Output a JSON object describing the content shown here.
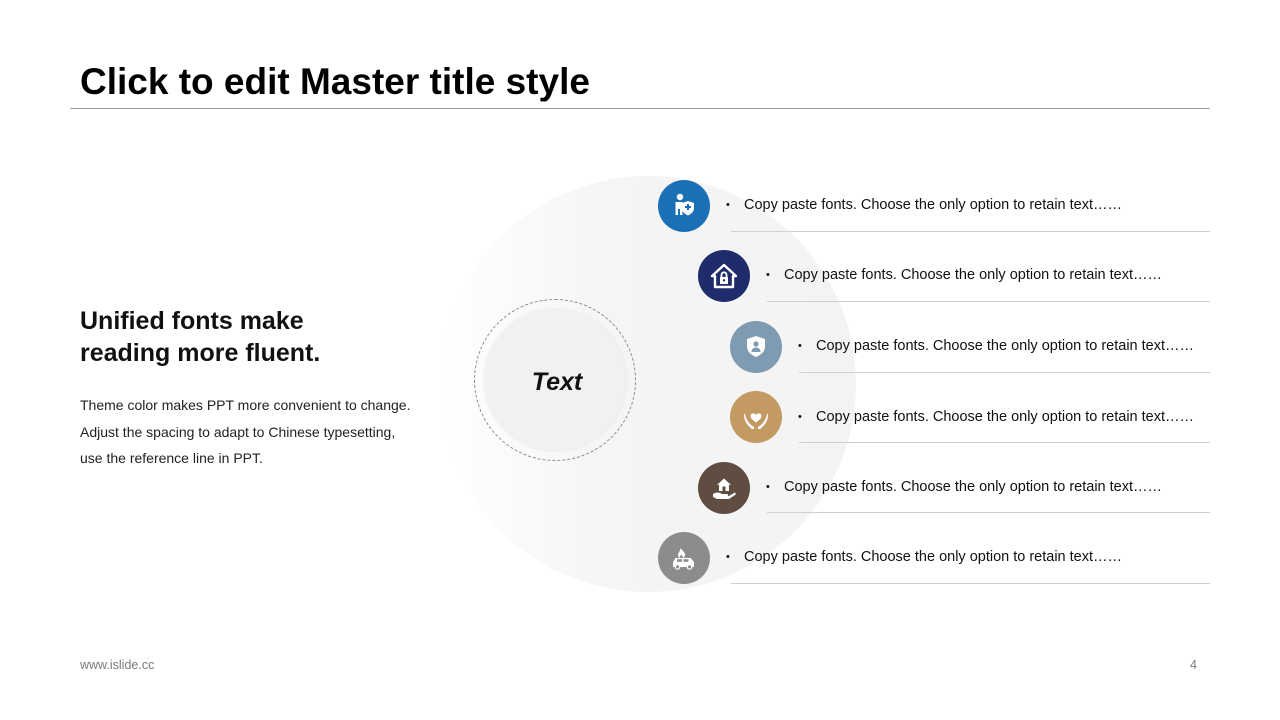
{
  "slide": {
    "title": "Click to edit Master title style",
    "heading_line1": "Unified fonts make",
    "heading_line2": "reading more fluent.",
    "body_lines": [
      "Theme color makes PPT more convenient to change.",
      "Adjust the spacing to adapt to Chinese typesetting,",
      "use the reference line in PPT."
    ],
    "center_label": "Text",
    "footer_url": "www.islide.cc",
    "page_number": "4"
  },
  "items": [
    {
      "text": "Copy paste fonts. Choose the only option to retain text……",
      "icon": "person-shield-icon",
      "color": "#1a6fb5"
    },
    {
      "text": "Copy paste fonts. Choose the only option to retain text……",
      "icon": "house-lock-icon",
      "color": "#1f2b6b"
    },
    {
      "text": "Copy paste fonts. Choose the only option to retain text……",
      "icon": "shield-person-icon",
      "color": "#7f9bb1"
    },
    {
      "text": "Copy paste fonts. Choose the only option to retain text……",
      "icon": "hands-heart-icon",
      "color": "#c29a62"
    },
    {
      "text": "Copy paste fonts. Choose the only option to retain text……",
      "icon": "hand-house-icon",
      "color": "#5e4d40"
    },
    {
      "text": "Copy paste fonts. Choose the only option to retain text……",
      "icon": "car-fire-icon",
      "color": "#8c8c8c"
    }
  ]
}
